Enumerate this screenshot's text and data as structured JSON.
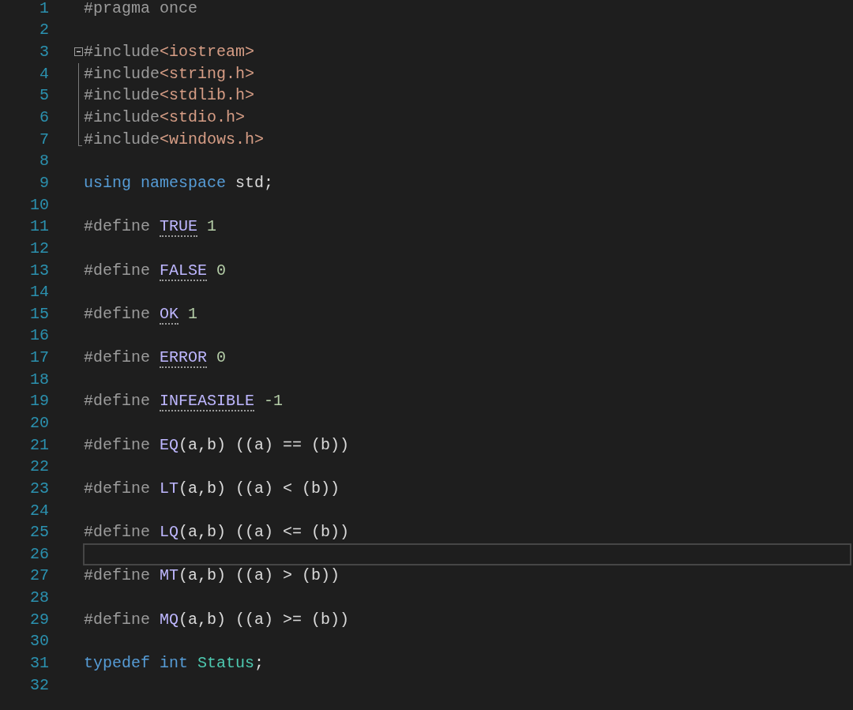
{
  "editor": {
    "lines": [
      {
        "number": "1",
        "tokens": [
          {
            "text": "#pragma once",
            "kind": "directive"
          }
        ]
      },
      {
        "number": "2"
      },
      {
        "number": "3",
        "kind": "fold_start",
        "expanded": true,
        "tokens": [
          {
            "text": "#include",
            "kind": "directive"
          },
          {
            "text": "<iostream>",
            "kind": "string"
          }
        ]
      },
      {
        "number": "4",
        "kind": "fold_body",
        "tokens": [
          {
            "text": "#include",
            "kind": "directive"
          },
          {
            "text": "<string.h>",
            "kind": "string"
          }
        ]
      },
      {
        "number": "5",
        "kind": "fold_body",
        "tokens": [
          {
            "text": "#include",
            "kind": "directive"
          },
          {
            "text": "<stdlib.h>",
            "kind": "string"
          }
        ]
      },
      {
        "number": "6",
        "kind": "fold_body",
        "tokens": [
          {
            "text": "#include",
            "kind": "directive"
          },
          {
            "text": "<stdio.h>",
            "kind": "string"
          }
        ]
      },
      {
        "number": "7",
        "kind": "fold_end",
        "tokens": [
          {
            "text": "#include",
            "kind": "directive"
          },
          {
            "text": "<windows.h>",
            "kind": "string"
          }
        ]
      },
      {
        "number": "8"
      },
      {
        "number": "9",
        "tokens": [
          {
            "text": "using",
            "kind": "keyword"
          },
          {
            "text": " namespace",
            "kind": "keyword"
          },
          {
            "text": " std;",
            "kind": "plain"
          }
        ]
      },
      {
        "number": "10"
      },
      {
        "number": "11",
        "tokens": [
          {
            "text": "#define ",
            "kind": "directive"
          },
          {
            "text": "TRUE",
            "kind": "macro",
            "hint": true
          },
          {
            "text": " 1",
            "kind": "number"
          }
        ]
      },
      {
        "number": "12"
      },
      {
        "number": "13",
        "tokens": [
          {
            "text": "#define ",
            "kind": "directive"
          },
          {
            "text": "FALSE",
            "kind": "macro",
            "hint": true
          },
          {
            "text": " 0",
            "kind": "number"
          }
        ]
      },
      {
        "number": "14"
      },
      {
        "number": "15",
        "tokens": [
          {
            "text": "#define ",
            "kind": "directive"
          },
          {
            "text": "OK",
            "kind": "macro",
            "hint": true
          },
          {
            "text": " 1",
            "kind": "number"
          }
        ]
      },
      {
        "number": "16"
      },
      {
        "number": "17",
        "tokens": [
          {
            "text": "#define ",
            "kind": "directive"
          },
          {
            "text": "ERROR",
            "kind": "macro",
            "hint": true
          },
          {
            "text": " 0",
            "kind": "number"
          }
        ]
      },
      {
        "number": "18"
      },
      {
        "number": "19",
        "tokens": [
          {
            "text": "#define ",
            "kind": "directive"
          },
          {
            "text": "INFEASIBLE",
            "kind": "macro",
            "hint": true
          },
          {
            "text": " -1",
            "kind": "number"
          }
        ]
      },
      {
        "number": "20"
      },
      {
        "number": "21",
        "tokens": [
          {
            "text": "#define ",
            "kind": "directive"
          },
          {
            "text": "EQ",
            "kind": "macro"
          },
          {
            "text": "(a,b) ((a) == (b))",
            "kind": "plain"
          }
        ]
      },
      {
        "number": "22"
      },
      {
        "number": "23",
        "tokens": [
          {
            "text": "#define ",
            "kind": "directive"
          },
          {
            "text": "LT",
            "kind": "macro"
          },
          {
            "text": "(a,b) ((a) < (b))",
            "kind": "plain"
          }
        ]
      },
      {
        "number": "24"
      },
      {
        "number": "25",
        "tokens": [
          {
            "text": "#define ",
            "kind": "directive"
          },
          {
            "text": "LQ",
            "kind": "macro"
          },
          {
            "text": "(a,b) ((a) <= (b))",
            "kind": "plain"
          }
        ]
      },
      {
        "number": "26",
        "current": true
      },
      {
        "number": "27",
        "tokens": [
          {
            "text": "#define ",
            "kind": "directive"
          },
          {
            "text": "MT",
            "kind": "macro"
          },
          {
            "text": "(a,b) ((a) > (b))",
            "kind": "plain"
          }
        ]
      },
      {
        "number": "28"
      },
      {
        "number": "29",
        "tokens": [
          {
            "text": "#define ",
            "kind": "directive"
          },
          {
            "text": "MQ",
            "kind": "macro"
          },
          {
            "text": "(a,b) ((a) >= (b))",
            "kind": "plain"
          }
        ]
      },
      {
        "number": "30"
      },
      {
        "number": "31",
        "tokens": [
          {
            "text": "typedef",
            "kind": "keyword"
          },
          {
            "text": " int",
            "kind": "keyword"
          },
          {
            "text": " Status",
            "kind": "type"
          },
          {
            "text": ";",
            "kind": "plain"
          }
        ]
      },
      {
        "number": "32"
      }
    ]
  }
}
